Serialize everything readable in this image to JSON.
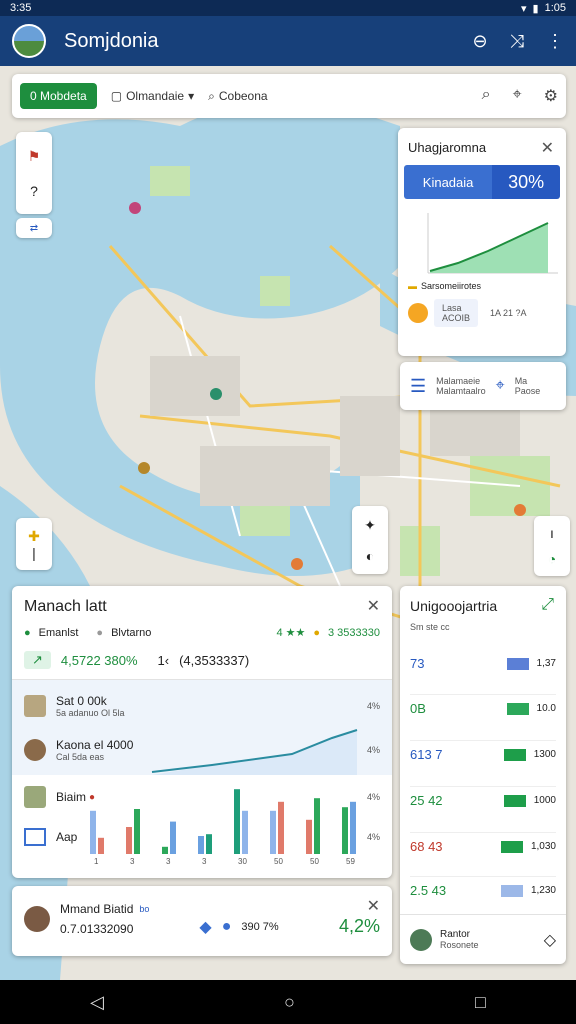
{
  "status_bar": {
    "time": "3:35",
    "right": "1:05"
  },
  "app_bar": {
    "title": "Somjdonia"
  },
  "toolbar": {
    "primary_label": "0 Mobdeta",
    "dropdown_label": "Olmandaie",
    "search_label": "Cobeona"
  },
  "map_left_controls": {
    "zoom_label": "?"
  },
  "trend_card": {
    "title": "Uhagjaromna",
    "kpi_label": "Kinadaia",
    "kpi_value": "30%",
    "section_label": "Sarsomeiirotes",
    "stat1_top": "Lasa",
    "stat1_bottom": "ACOIB",
    "stat2": "1A 21 ?A"
  },
  "legend_card": {
    "line1": "Malamaeie",
    "line2": "Ma",
    "line3": "Malamtaalro",
    "line4": "Paose"
  },
  "market_card": {
    "title": "Manach latt",
    "filter_a": "Emanlst",
    "filter_b": "Blvtarno",
    "rating": "4 ★★",
    "rating_value": "3 3533330",
    "value_main": "4,5722 380%",
    "value_secondary": "(4,3533337)",
    "value_prefix": "1‹",
    "rows": [
      {
        "title": "Sat 0 00k",
        "sub": "5a adanuo Ol 5la",
        "pct": "4%"
      },
      {
        "title": "Kaona el 4000",
        "sub": "Cal 5da eas",
        "pct": "4%"
      },
      {
        "title": "Biaim",
        "sub": "",
        "pct": "4%"
      },
      {
        "title": "Aap",
        "sub": "",
        "pct": "4%"
      }
    ],
    "bar_labels": [
      "1",
      "3",
      "3",
      "3",
      "30",
      "50",
      "50",
      "59"
    ]
  },
  "chart_data": {
    "type": "bar",
    "categories": [
      "1",
      "3",
      "3",
      "3",
      "30",
      "50",
      "50",
      "59"
    ],
    "series": [
      {
        "values": [
          48,
          30,
          8,
          20,
          72,
          48,
          38,
          52
        ]
      },
      {
        "values": [
          18,
          50,
          36,
          22,
          48,
          58,
          62,
          58
        ]
      }
    ]
  },
  "profile_card": {
    "name": "Mmand Biatid",
    "badge": "bo",
    "balance": "0.7.01332090",
    "stat": "390 7%",
    "percent": "4,2%"
  },
  "side_card": {
    "title": "Unigooojartria",
    "subtitle": "Sm ste cc",
    "rows": [
      {
        "left": "73",
        "right": "1,37",
        "color": "#5b7fd6"
      },
      {
        "left": "0B",
        "right": "10.0",
        "color": "#2ca85a"
      },
      {
        "left": "613 7",
        "right": "1300",
        "color": "#1e9e4a"
      },
      {
        "left": "25 42",
        "right": "1000",
        "color": "#1e9e4a"
      },
      {
        "left": "68 43",
        "right": "1,030",
        "color": "#1e9e4a"
      },
      {
        "left": "2.5 43",
        "right": "1,230",
        "color": "#9cb8e8"
      }
    ],
    "footer_name": "Rantor",
    "footer_sub": "Rosonete"
  }
}
